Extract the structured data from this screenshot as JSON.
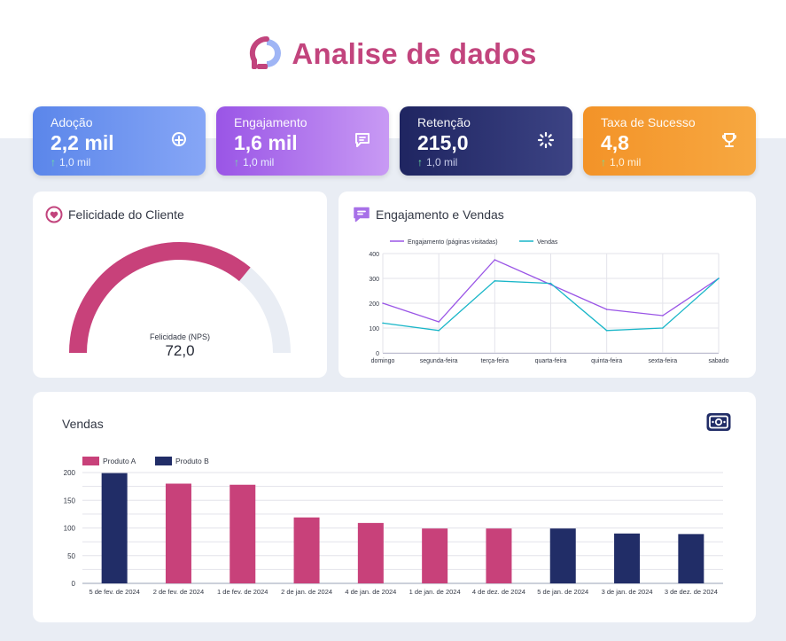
{
  "header": {
    "title": "Analise de dados"
  },
  "kpis": [
    {
      "label": "Adoção",
      "value": "2,2 mil",
      "delta": "1,0 mil",
      "icon": "plus-circle-icon"
    },
    {
      "label": "Engajamento",
      "value": "1,6 mil",
      "delta": "1,0 mil",
      "icon": "message-icon"
    },
    {
      "label": "Retenção",
      "value": "215,0",
      "delta": "1,0 mil",
      "icon": "loading-icon"
    },
    {
      "label": "Taxa de Sucesso",
      "value": "4,8",
      "delta": "1,0 mil",
      "icon": "trophy-icon"
    }
  ],
  "felicidade": {
    "title": "Felicidade do Cliente",
    "gauge_label": "Felicidade (NPS)",
    "gauge_value": "72,0",
    "gauge_fraction": 0.72,
    "colors": {
      "fill": "#c8417a",
      "track": "#e9edf4"
    }
  },
  "engajamento": {
    "title": "Engajamento e Vendas",
    "chart_data": {
      "type": "line",
      "categories": [
        "domingo",
        "segunda-feira",
        "terça-feira",
        "quarta-feira",
        "quinta-feira",
        "sexta-feira",
        "sabado"
      ],
      "series": [
        {
          "name": "Engajamento (páginas visitadas)",
          "values": [
            200,
            125,
            375,
            275,
            175,
            150,
            300
          ],
          "color": "#9a55e6"
        },
        {
          "name": "Vendas",
          "values": [
            120,
            90,
            290,
            280,
            90,
            100,
            300
          ],
          "color": "#19b6c8"
        }
      ],
      "ylim": [
        0,
        400
      ],
      "yticks": [
        "0",
        "100",
        "200",
        "300",
        "400"
      ],
      "grid": true,
      "legend": "top-left"
    }
  },
  "vendas": {
    "title": "Vendas",
    "icon": "money-icon",
    "chart_data": {
      "type": "bar",
      "categories": [
        "5 de fev. de 2024",
        "2 de fev. de 2024",
        "1 de fev. de 2024",
        "2 de jan. de 2024",
        "4 de jan. de 2024",
        "1 de jan. de 2024",
        "4 de dez. de 2024",
        "5 de jan. de 2024",
        "3 de jan. de 2024",
        "3 de dez. de 2024"
      ],
      "series": [
        {
          "name": "Produto A",
          "color": "#c8417a",
          "values": [
            null,
            180,
            178,
            119,
            109,
            99,
            99,
            null,
            null,
            null
          ]
        },
        {
          "name": "Produto B",
          "color": "#212d67",
          "values": [
            199,
            null,
            null,
            null,
            null,
            null,
            null,
            99,
            90,
            89
          ]
        }
      ],
      "ylim": [
        0,
        200
      ],
      "yticks": [
        "0",
        "50",
        "100",
        "150",
        "200"
      ],
      "grid": true,
      "legend": "top-left"
    }
  }
}
